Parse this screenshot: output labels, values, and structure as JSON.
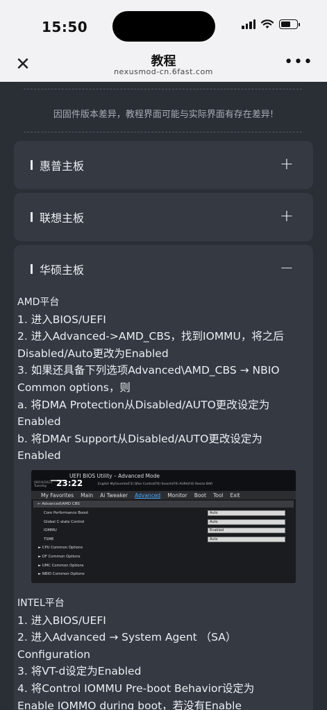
{
  "status_bar": {
    "time": "15:50"
  },
  "header": {
    "title": "教程",
    "url": "nexusmod-cn.6fast.com"
  },
  "notice": "因固件版本差异，教程界面可能与实际界面有存在差异!",
  "panels": [
    {
      "title": "惠普主板",
      "toggle": "+"
    },
    {
      "title": "联想主板",
      "toggle": "+"
    },
    {
      "title": "华硕主板",
      "toggle": "−"
    }
  ],
  "asus": {
    "amd_heading": "AMD平台",
    "amd_steps": [
      "1. 进入BIOS/UEFI",
      "2. 进入Advanced->AMD_CBS，找到IOMMU，将之后Disabled/Auto更改为Enabled",
      "3. 如果还具备下列选项Advanced\\AMD_CBS → NBIO Common options，则",
      "a. 将DMA Protection从Disabled/AUTO更改设定为Enabled",
      "b. 将DMAr Support从Disabled/AUTO更改设定为Enabled"
    ],
    "intel_heading": "INTEL平台",
    "intel_steps": [
      "1. 进入BIOS/UEFI",
      "2. 进入Advanced → System Agent （SA） Configuration",
      "3. 将VT-d设定为Enabled",
      "4. 将Control IOMMU Pre-boot Behavior设定为Enable IOMMO during boot，若没有Enable"
    ]
  },
  "bios": {
    "heading": "UEFI BIOS Utility – Advanced Mode",
    "date": "09/19/2023 Tuesday",
    "clock": "23:22",
    "tools": "English  MyFavorite(F3)  Qfan Control(F6)  Search(F9)  AURA(F4)  Resize BAR",
    "menu": [
      "My Favorites",
      "Main",
      "Ai Tweaker",
      "Advanced",
      "Monitor",
      "Boot",
      "Tool",
      "Exit"
    ],
    "active_menu": "Advanced",
    "path": "←  Advanced\\AMD CBS",
    "settings": [
      {
        "label": "Core Performance Boost",
        "value": "Auto"
      },
      {
        "label": "Global C-state Control",
        "value": "Auto"
      },
      {
        "label": "IOMMU",
        "value": "Enabled"
      },
      {
        "label": "TSME",
        "value": "Auto"
      }
    ],
    "submenus": [
      "► CPU Common Options",
      "► DF Common Options",
      "► UMC Common Options",
      "► NBIO Common Options"
    ]
  }
}
